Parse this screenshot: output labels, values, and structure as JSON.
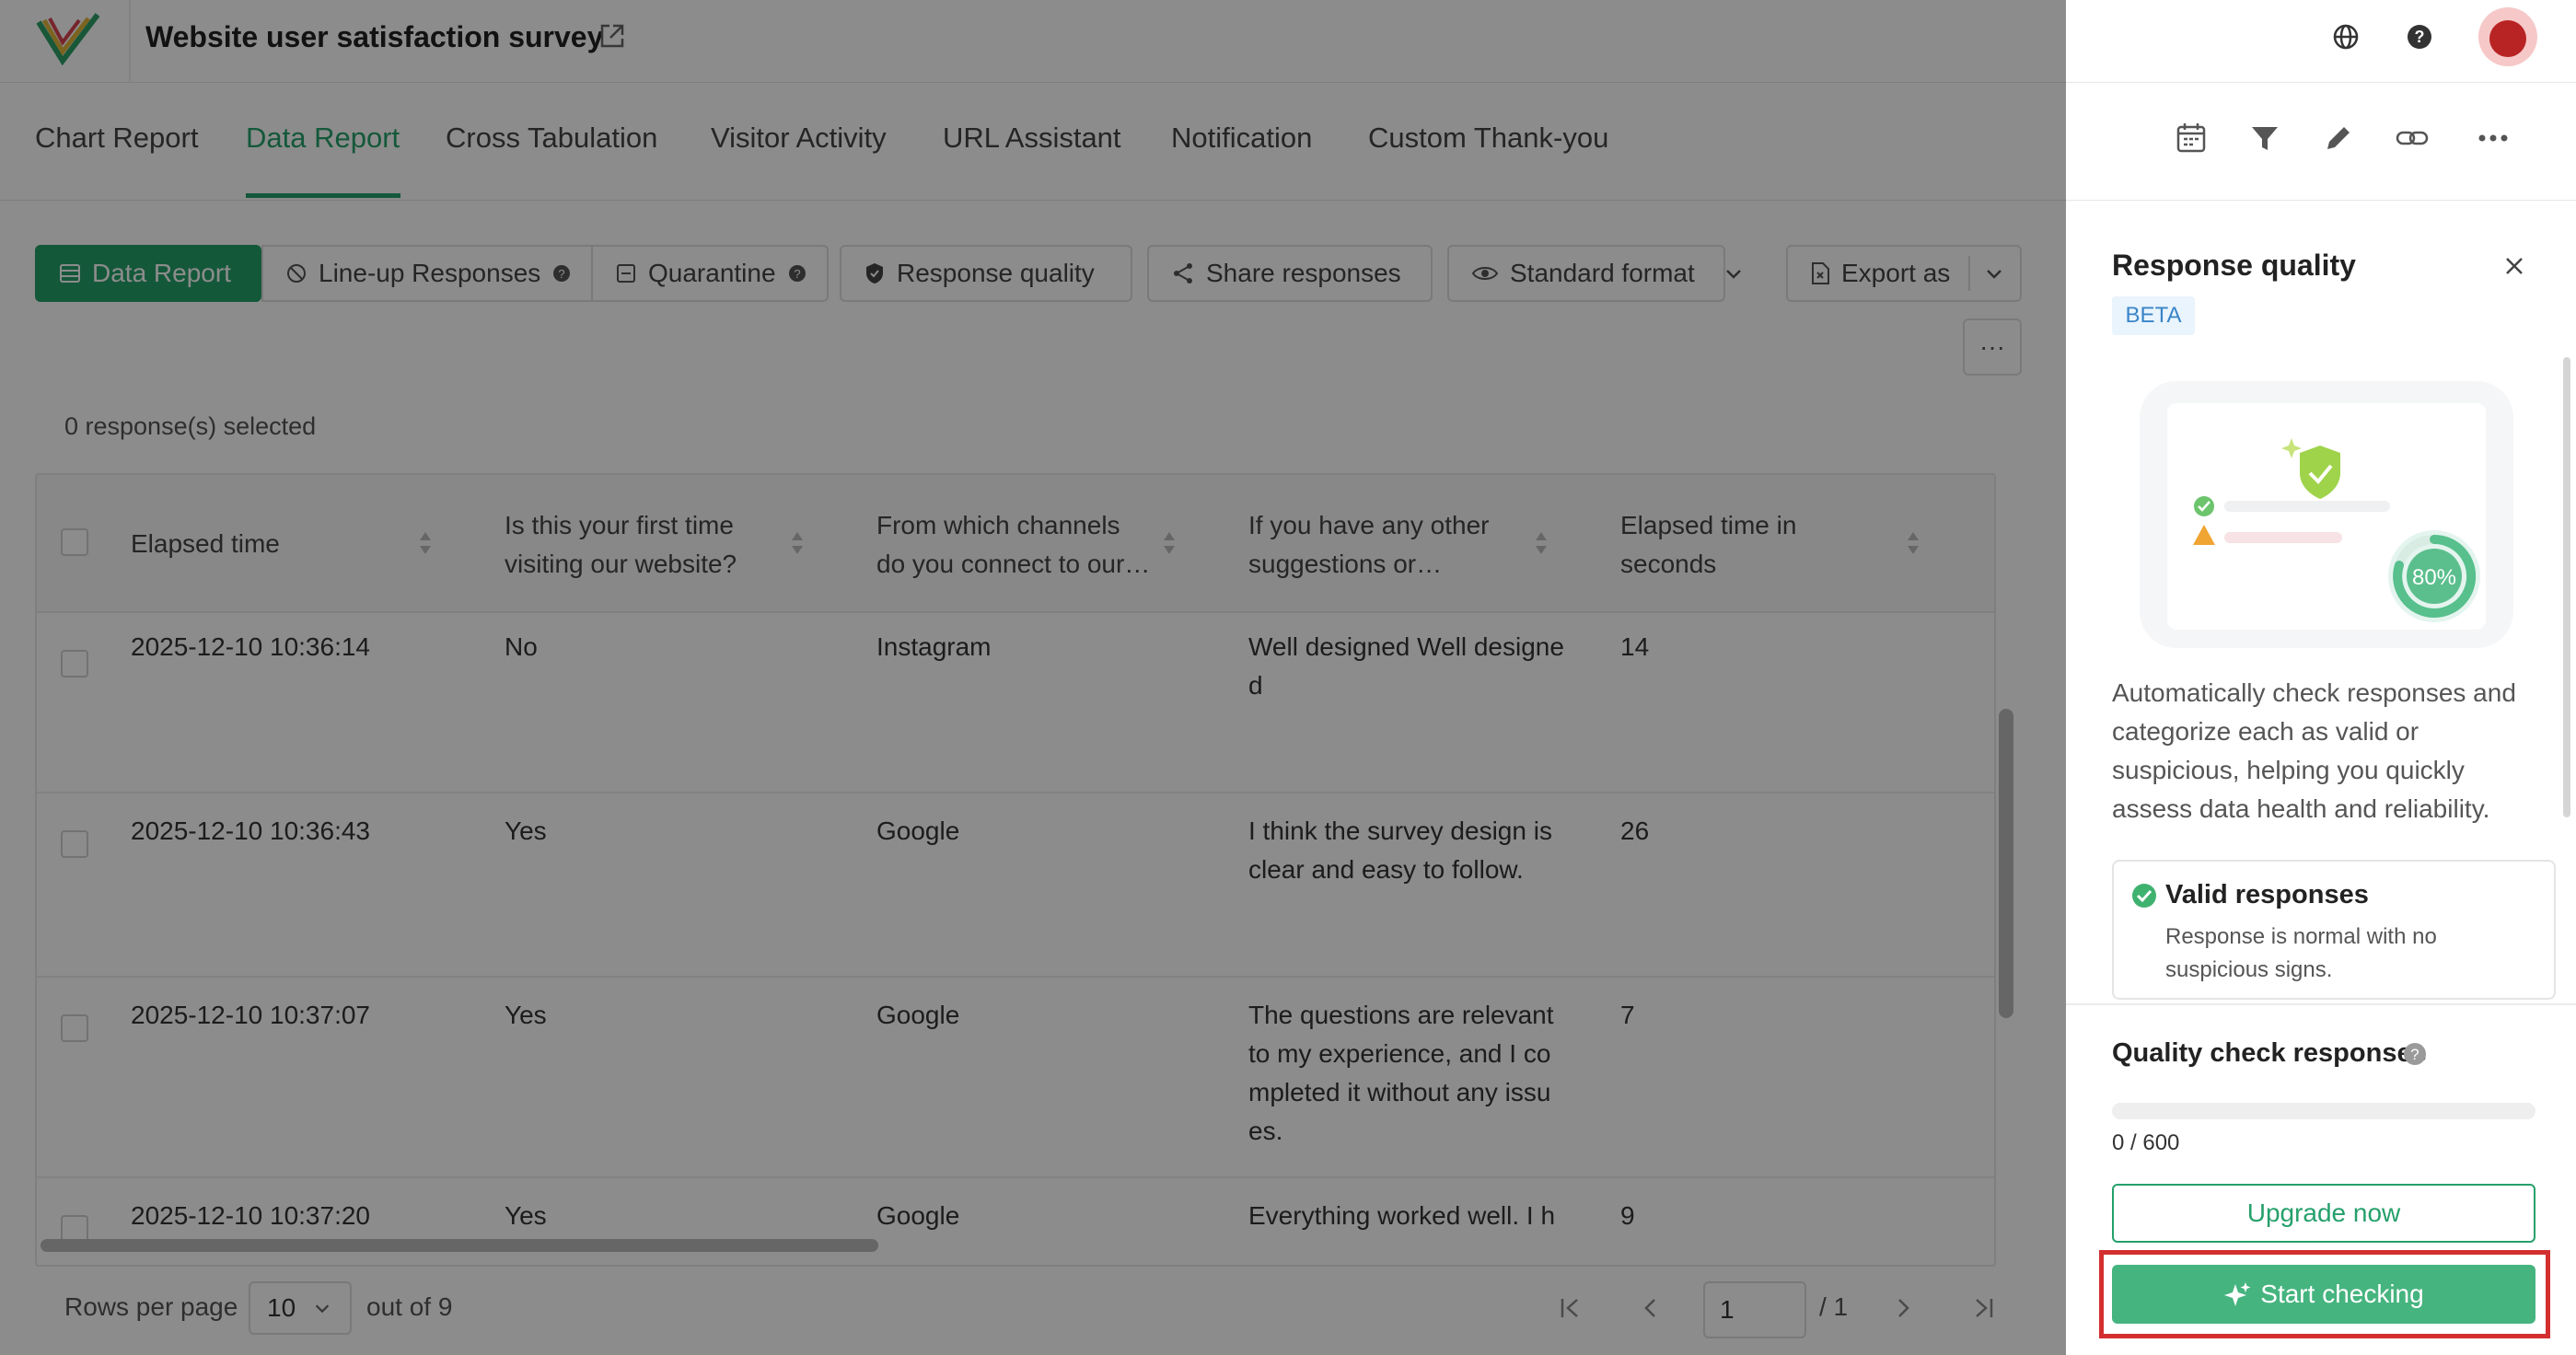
{
  "header": {
    "survey_title": "Website user satisfaction survey",
    "icons": [
      "logo-icon",
      "external-link-icon",
      "globe-icon",
      "help-icon",
      "avatar"
    ]
  },
  "nav": {
    "tabs": [
      {
        "label": "Chart Report",
        "active": false
      },
      {
        "label": "Data Report",
        "active": true
      },
      {
        "label": "Cross Tabulation",
        "active": false
      },
      {
        "label": "Visitor Activity",
        "active": false
      },
      {
        "label": "URL Assistant",
        "active": false
      },
      {
        "label": "Notification",
        "active": false
      },
      {
        "label": "Custom Thank-you",
        "active": false
      }
    ],
    "right_icons": [
      "calendar-icon",
      "filter-icon",
      "pencil-icon",
      "link-icon",
      "more-icon"
    ]
  },
  "toolbar": {
    "data_report": "Data Report",
    "lineup": "Line-up Responses",
    "quarantine": "Quarantine",
    "response_quality": "Response quality",
    "share": "Share responses",
    "standard_format": "Standard format",
    "export": "Export as",
    "more": "···"
  },
  "selection": {
    "count_text": "0 response(s) selected"
  },
  "table": {
    "columns": [
      "Elapsed time",
      "Is this your first time visiting our website?",
      "From which channels do you connect to our…",
      "If you have any other suggestions or…",
      "Elapsed time in seconds"
    ],
    "rows": [
      {
        "time": "2025-12-10 10:36:14",
        "first": "No",
        "channel": "Instagram",
        "suggestion": "Well designed Well designe d",
        "seconds": "14"
      },
      {
        "time": "2025-12-10 10:36:43",
        "first": "Yes",
        "channel": "Google",
        "suggestion": "I think the survey design is clear and easy to follow.",
        "seconds": "26"
      },
      {
        "time": "2025-12-10 10:37:07",
        "first": "Yes",
        "channel": "Google",
        "suggestion": "The questions are relevant to my experience, and I co mpleted it without any issu es.",
        "seconds": "7"
      },
      {
        "time": "2025-12-10 10:37:20",
        "first": "Yes",
        "channel": "Google",
        "suggestion": "Everything worked well. I h",
        "seconds": "9"
      }
    ]
  },
  "pagination": {
    "rows_per_page_label": "Rows per page",
    "rows_per_page": "10",
    "out_of": "out of 9",
    "page": "1",
    "total_pages": "/ 1"
  },
  "panel": {
    "title": "Response quality",
    "badge": "BETA",
    "illustration_percent": "80%",
    "description": "Automatically check responses and categorize each as valid or suspicious, helping you quickly assess data health and reliability.",
    "valid_title": "Valid responses",
    "valid_desc": "Response is normal with no suspicious signs.",
    "quota_label": "Quality check responses",
    "quota_used": 0,
    "quota_total": 600,
    "quota_text": "0 / 600",
    "upgrade": "Upgrade now",
    "start": "Start checking"
  },
  "colors": {
    "brand": "#26a06b",
    "highlight": "#d32f2f",
    "beta": "#3a85c8"
  }
}
